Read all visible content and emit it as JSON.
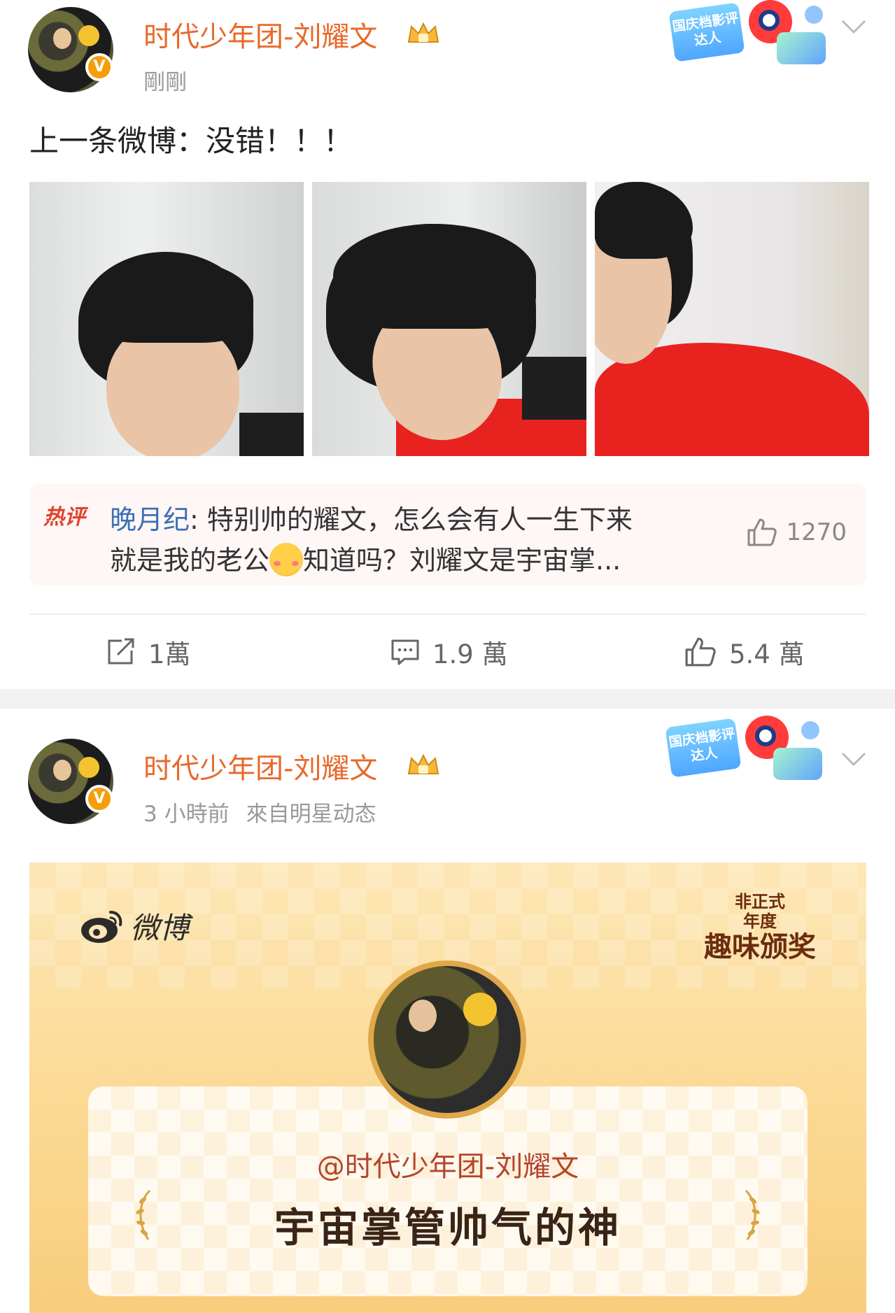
{
  "post1": {
    "username": "时代少年团-刘耀文",
    "time": "剛剛",
    "text": "上一条微博：没错！！！",
    "badge_text": "国庆档影评达人",
    "hot_comment": {
      "tag": "热评",
      "commenter": "晚月纪",
      "line1_rest": ": 特别帅的耀文，怎么会有人一生下来",
      "line2_part1": "就是我的老公",
      "line2_part2": "知道吗？刘耀文是宇宙掌...",
      "likes": "1270"
    },
    "actions": {
      "repost": "1萬",
      "comment": "1.9 萬",
      "like": "5.4 萬"
    }
  },
  "post2": {
    "username": "时代少年团-刘耀文",
    "time": "3 小時前",
    "source": "來自明星动态",
    "badge_text": "国庆档影评达人",
    "promo": {
      "brand": "微博",
      "mark_small_1": "非正式",
      "mark_small_2": "年度",
      "mark_big": "趣味颁奖",
      "handle": "@时代少年团-刘耀文",
      "award_title": "宇宙掌管帅气的神"
    }
  },
  "colors": {
    "username": "#e8692b",
    "commenter": "#3b6fb6",
    "hot_tag": "#e0432e",
    "promo_bg": "#fbd993"
  },
  "icons": [
    "crown-icon",
    "verified-icon",
    "chevron-down-icon",
    "thumb-up-icon",
    "repost-icon",
    "comment-icon",
    "weibo-logo-icon",
    "laurel-icon"
  ]
}
